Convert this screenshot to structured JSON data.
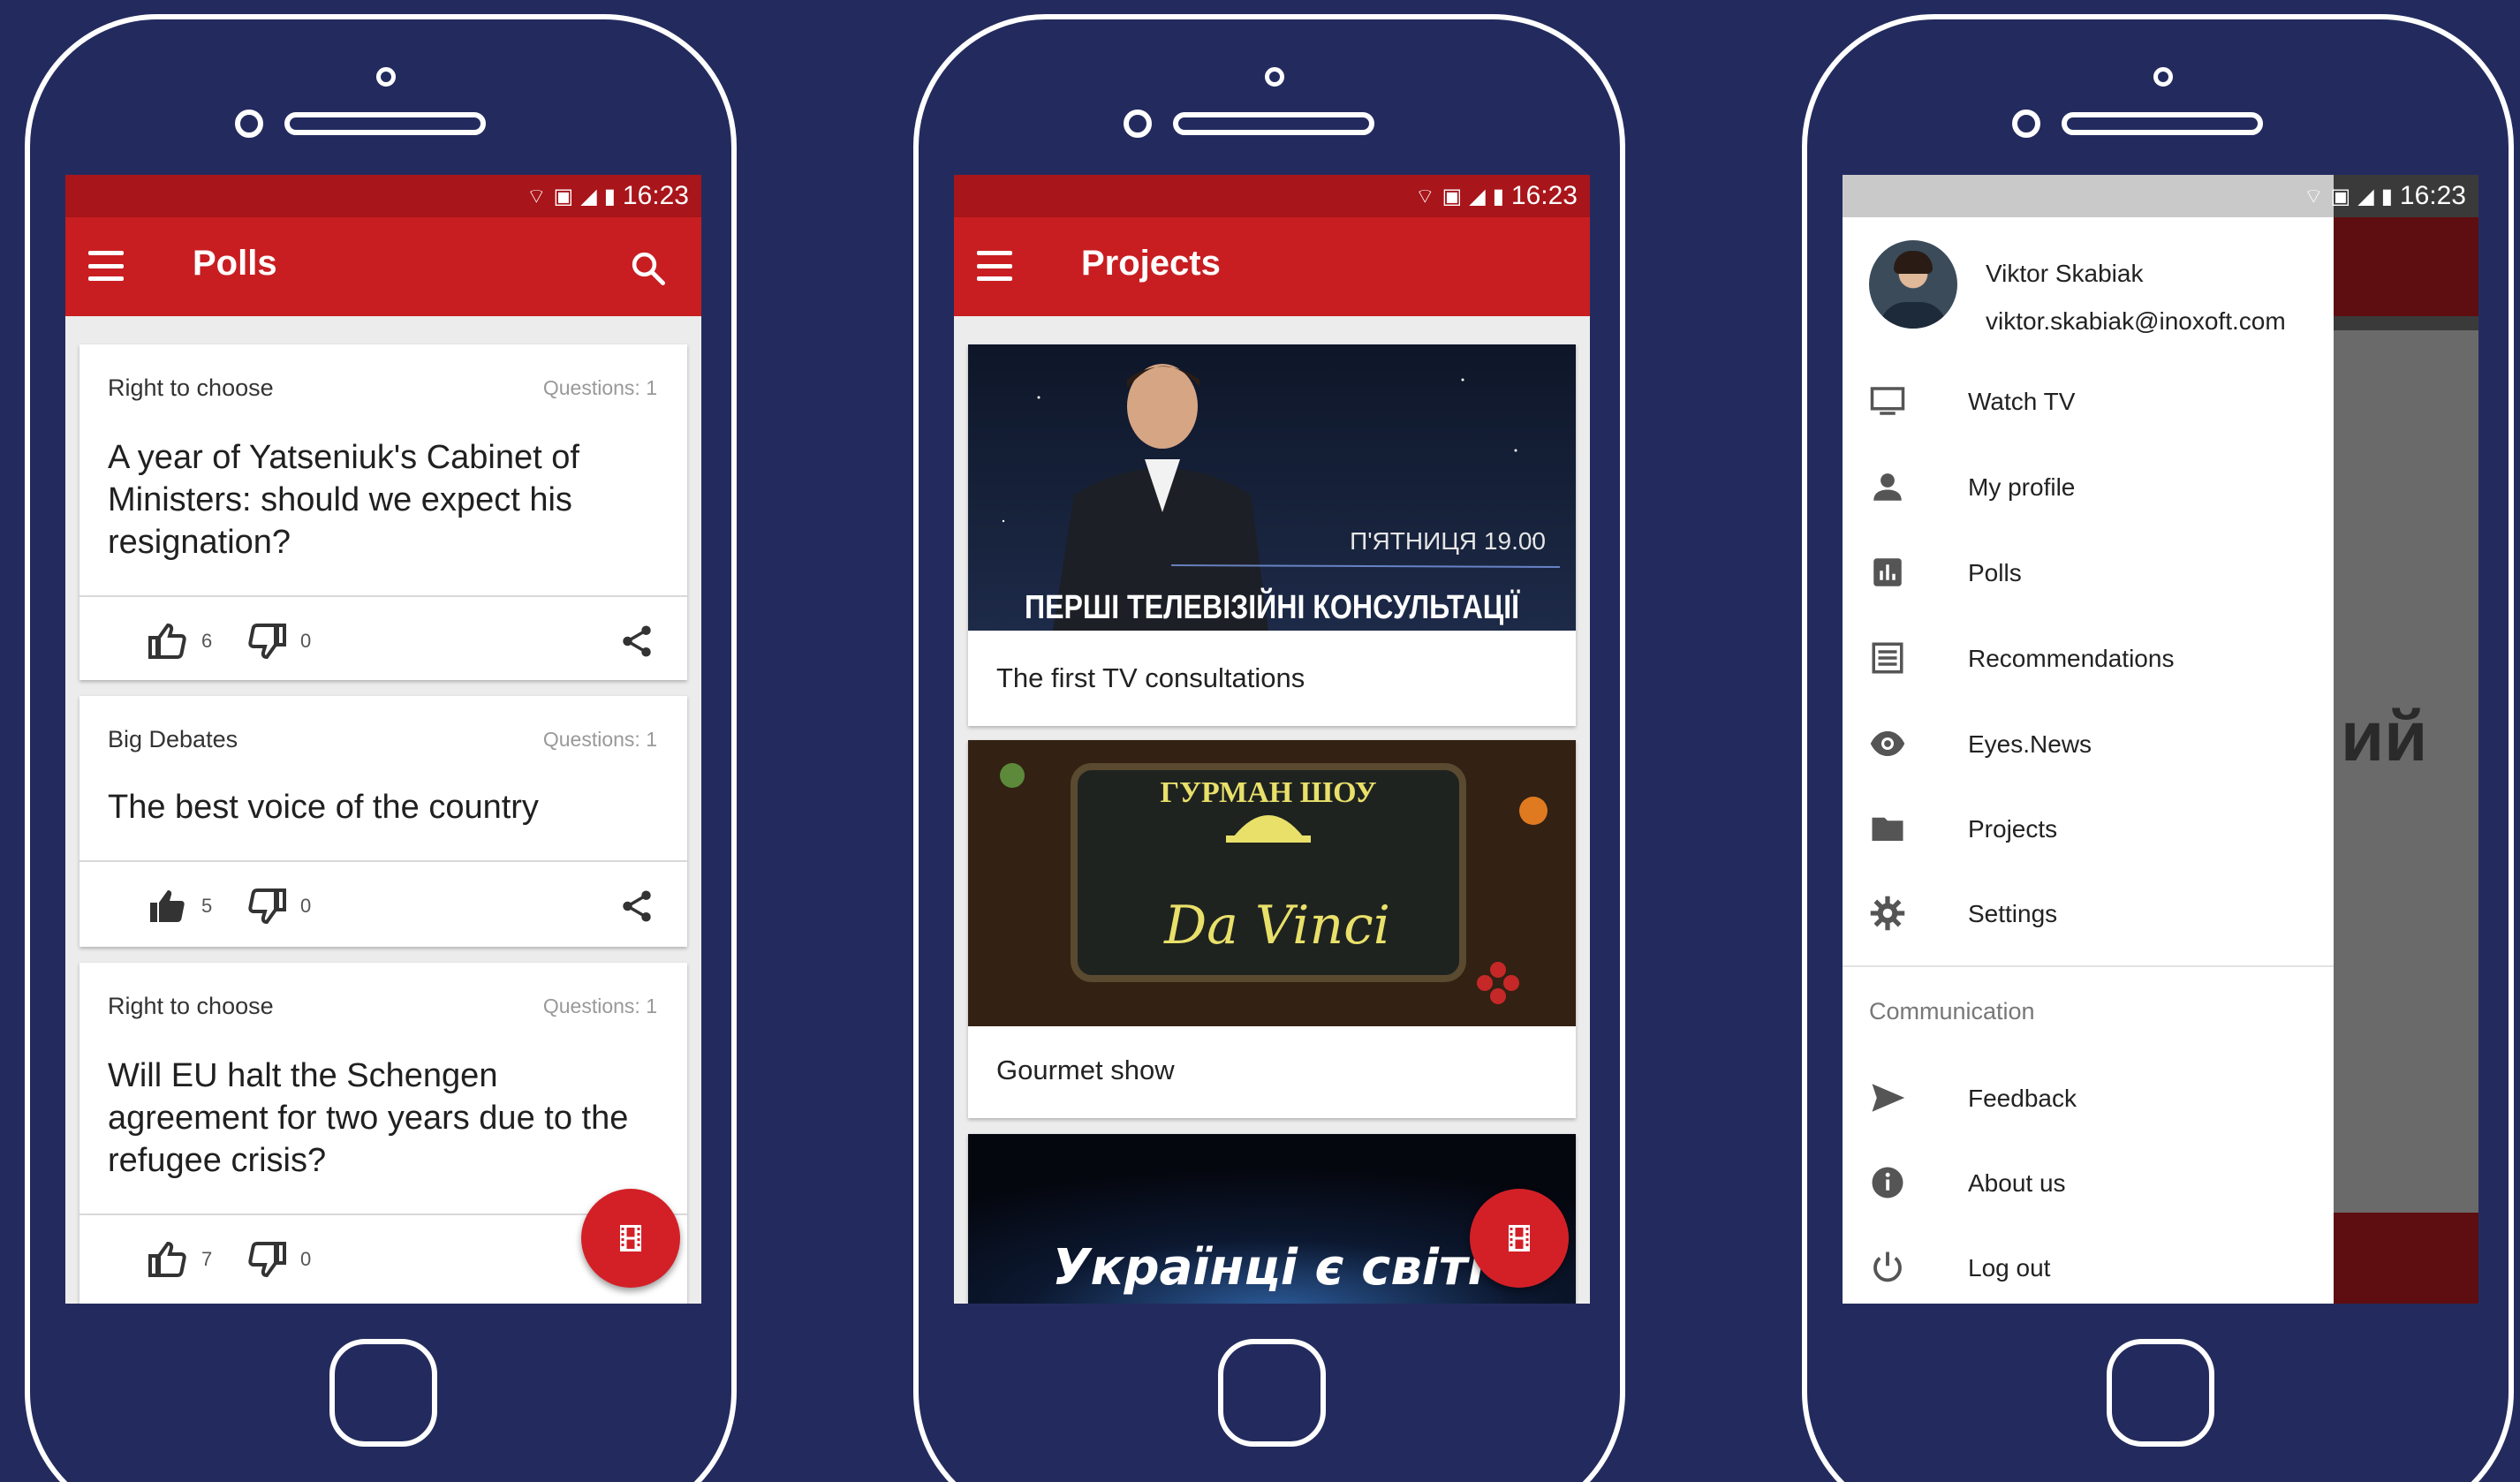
{
  "status_time": "16:23",
  "polls_screen": {
    "title": "Polls",
    "cards": [
      {
        "category": "Right to choose",
        "questions": "Questions: 1",
        "question": "A year of Yatseniuk's Cabinet of Ministers: should we expect his resignation?",
        "likes": "6",
        "dislikes": "0"
      },
      {
        "category": "Big Debates",
        "questions": "Questions: 1",
        "question": "The best voice of the country",
        "likes": "5",
        "dislikes": "0"
      },
      {
        "category": "Right to choose",
        "questions": "Questions: 1",
        "question": "Will EU halt the Schengen agreement for two years due to the refugee crisis?",
        "likes": "7",
        "dislikes": "0"
      }
    ]
  },
  "projects_screen": {
    "title": "Projects",
    "projects": [
      {
        "banner": "ПЕРШІ ТЕЛЕВІЗІЙНІ КОНСУЛЬТАЦІЇ",
        "schedule": "П'ЯТНИЦЯ 19.00",
        "caption": "The first TV consultations"
      },
      {
        "banner_top": "ГУРМАН ШОУ",
        "banner_script": "Da Vinci",
        "caption": "Gourmet show"
      },
      {
        "banner": "Українці є світі"
      }
    ]
  },
  "drawer": {
    "user_name": "Viktor Skabiak",
    "user_email": "viktor.skabiak@inoxoft.com",
    "items": [
      {
        "label": "Watch TV",
        "icon": "tv-icon"
      },
      {
        "label": "My profile",
        "icon": "person-icon"
      },
      {
        "label": "Polls",
        "icon": "poll-icon"
      },
      {
        "label": "Recommendations",
        "icon": "list-icon"
      },
      {
        "label": "Eyes.News",
        "icon": "eye-icon"
      },
      {
        "label": "Projects",
        "icon": "folder-icon"
      },
      {
        "label": "Settings",
        "icon": "gear-icon"
      }
    ],
    "section_label": "Communication",
    "comm_items": [
      {
        "label": "Feedback",
        "icon": "send-icon"
      },
      {
        "label": "About us",
        "icon": "info-icon"
      },
      {
        "label": "Log out",
        "icon": "power-icon"
      }
    ],
    "background_partial": "ий"
  },
  "colors": {
    "background": "#232b5e",
    "appbar": "#c81e22",
    "statusbar": "#a8151a",
    "fab": "#d32027"
  }
}
